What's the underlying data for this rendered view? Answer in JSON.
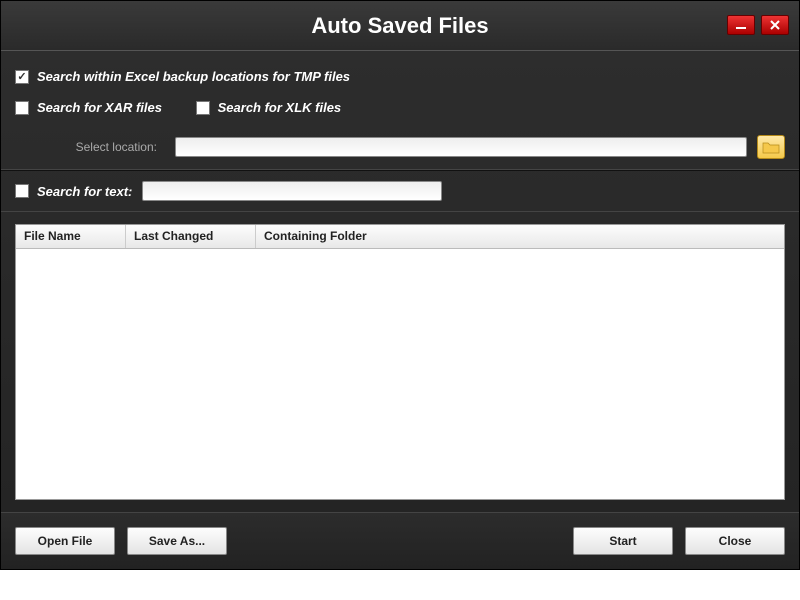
{
  "window": {
    "title": "Auto Saved Files"
  },
  "options": {
    "tmp": {
      "label": "Search within Excel backup locations for TMP files",
      "checked": true
    },
    "xar": {
      "label": "Search for XAR files",
      "checked": false
    },
    "xlk": {
      "label": "Search for XLK files",
      "checked": false
    },
    "location_label": "Select location:",
    "location_value": ""
  },
  "searchtext": {
    "label": "Search for text:",
    "checked": false,
    "value": ""
  },
  "table": {
    "columns": {
      "c1": "File Name",
      "c2": "Last Changed",
      "c3": "Containing Folder"
    },
    "rows": []
  },
  "buttons": {
    "open": "Open File",
    "saveas": "Save As...",
    "start": "Start",
    "close": "Close"
  }
}
